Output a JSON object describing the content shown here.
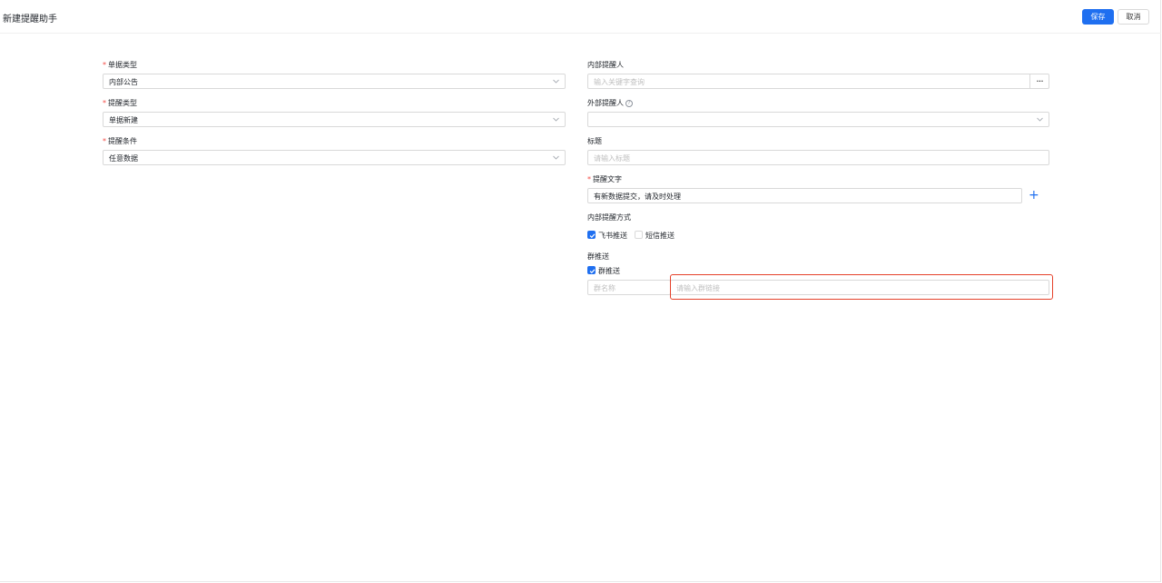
{
  "header": {
    "title": "新建提醒助手",
    "save_label": "保存",
    "cancel_label": "取消"
  },
  "left": {
    "doc_type": {
      "label": "单据类型",
      "value": "内部公告"
    },
    "remind_type": {
      "label": "提醒类型",
      "value": "单据新建"
    },
    "remind_condition": {
      "label": "提醒条件",
      "value": "任意数据"
    }
  },
  "right": {
    "internal_reminder": {
      "label": "内部提醒人",
      "placeholder": "输入关键字查询",
      "more": "···"
    },
    "external_reminder": {
      "label": "外部提醒人",
      "value": ""
    },
    "title_field": {
      "label": "标题",
      "placeholder": "请输入标题"
    },
    "remind_text": {
      "label": "提醒文字",
      "value": "有新数据提交，请及时处理",
      "add": "+"
    },
    "internal_method": {
      "label": "内部提醒方式",
      "options": [
        {
          "label": "飞书推送",
          "checked": true
        },
        {
          "label": "短信推送",
          "checked": false
        }
      ]
    },
    "group_push": {
      "label": "群推送",
      "checkbox_label": "群推送",
      "checked": true,
      "name_placeholder": "群名称",
      "link_placeholder": "请输入群链接"
    }
  },
  "icons": {
    "chevron": "chevron-down-icon",
    "help": "help-circle-icon",
    "check": "check-icon",
    "plus": "plus-icon"
  },
  "colors": {
    "primary": "#1f6ff0",
    "required": "#f54a45",
    "highlight": "#e5412a"
  }
}
